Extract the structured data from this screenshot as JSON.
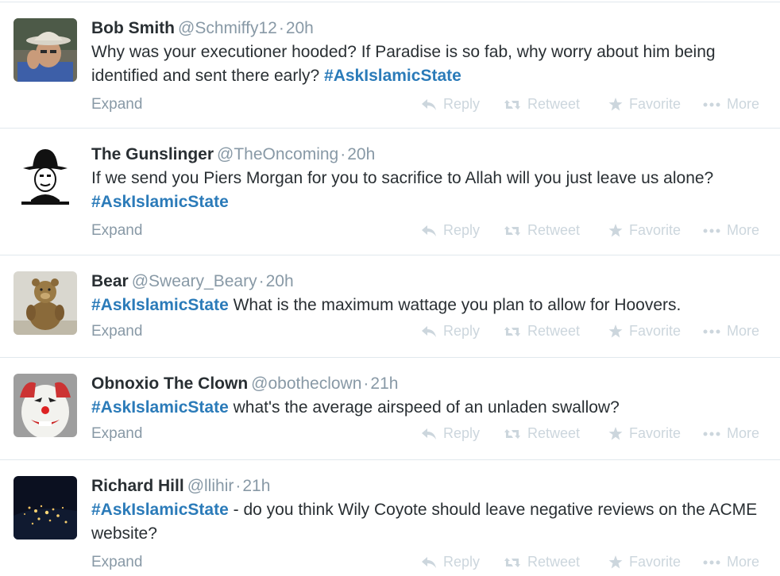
{
  "tweets": [
    {
      "fullname": "Bob Smith",
      "username": "@Schmiffy12",
      "time": "20h",
      "segments": [
        {
          "type": "text",
          "value": "Why was your executioner hooded? If Paradise is so fab, why worry about him being identified and sent there early? "
        },
        {
          "type": "hashtag",
          "value": "#AskIslamicState"
        }
      ]
    },
    {
      "fullname": "The Gunslinger",
      "username": "@TheOncoming",
      "time": "20h",
      "segments": [
        {
          "type": "text",
          "value": "If we send you Piers Morgan for you to sacrifice to Allah will you just leave us alone? "
        },
        {
          "type": "hashtag",
          "value": "#AskIslamicState"
        }
      ]
    },
    {
      "fullname": "Bear",
      "username": "@Sweary_Beary",
      "time": "20h",
      "segments": [
        {
          "type": "hashtag",
          "value": "#AskIslamicState"
        },
        {
          "type": "text",
          "value": " What is the maximum wattage you plan to allow for Hoovers."
        }
      ]
    },
    {
      "fullname": "Obnoxio The Clown",
      "username": "@obotheclown",
      "time": "21h",
      "segments": [
        {
          "type": "hashtag",
          "value": "#AskIslamicState"
        },
        {
          "type": "text",
          "value": " what's the average airspeed of an unladen swallow?"
        }
      ]
    },
    {
      "fullname": "Richard Hill",
      "username": "@llihir",
      "time": "21h",
      "segments": [
        {
          "type": "hashtag",
          "value": "#AskIslamicState"
        },
        {
          "type": "text",
          "value": " - do you think Wily Coyote should leave negative reviews on the ACME website?"
        }
      ]
    }
  ],
  "labels": {
    "expand": "Expand",
    "reply": "Reply",
    "retweet": "Retweet",
    "favorite": "Favorite",
    "more": "More",
    "separator": "·"
  },
  "avatars": [
    "avatar-man-in-hat",
    "avatar-gunslinger",
    "avatar-teddy-bear",
    "avatar-clown",
    "avatar-earth-at-night"
  ],
  "colors": {
    "name": "#292f33",
    "meta": "#8899a6",
    "hashtag": "#2b7bb9",
    "action": "#ccd6dd",
    "divider": "#e1e8ed"
  }
}
